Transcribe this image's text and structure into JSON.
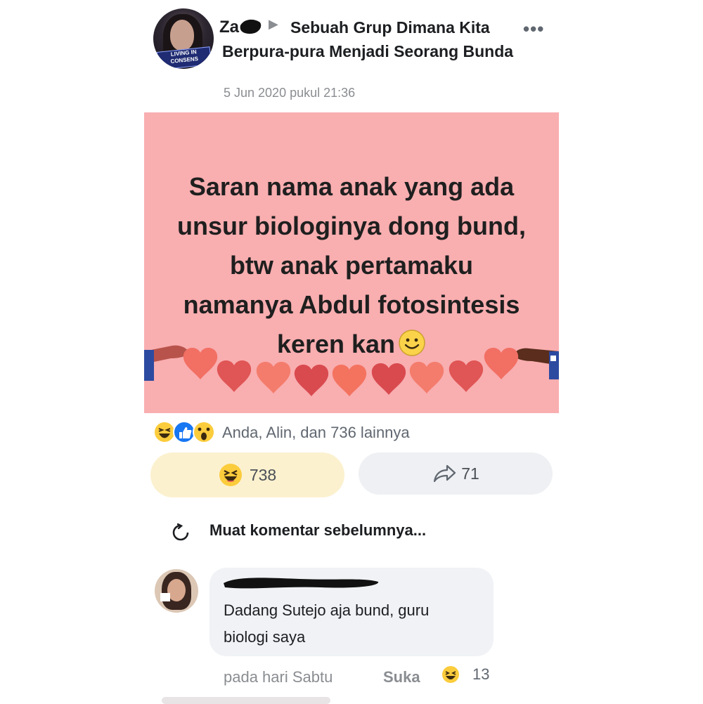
{
  "post": {
    "author_visible": "Za",
    "group_name": "Sebuah Grup Dimana Kita Berpura-pura Menjadi Seorang Bunda",
    "timestamp": "5 Jun 2020 pukul 21:36",
    "more_icon": "more-dots-icon",
    "text": "Saran nama anak yang ada unsur biologinya dong bund, btw anak pertamaku namanya Abdul fotosintesis keren kan",
    "text_lines": [
      "Saran nama anak yang ada",
      "unsur biologinya dong bund,",
      "btw anak pertamaku",
      "namanya Abdul fotosintesis",
      "keren kan"
    ],
    "background_color": "#f9aeb0",
    "avatar_badge": "LIVING IN CONSENS"
  },
  "reactions": {
    "icons": [
      "haha-icon",
      "like-icon",
      "wow-icon"
    ],
    "summary": "Anda, Alin, dan 736 lainnya",
    "react_count": "738",
    "share_count": "71",
    "active_reaction_color": "#fcf1cf"
  },
  "comments": {
    "load_more_label": "Muat komentar sebelumnya...",
    "items": [
      {
        "text": "Dadang Sutejo aja bund, guru biologi saya",
        "text_lines": [
          "Dadang Sutejo aja bund, guru",
          "biologi saya"
        ],
        "time": "pada hari Sabtu",
        "like_label": "Suka",
        "reaction_count": "13"
      }
    ]
  }
}
